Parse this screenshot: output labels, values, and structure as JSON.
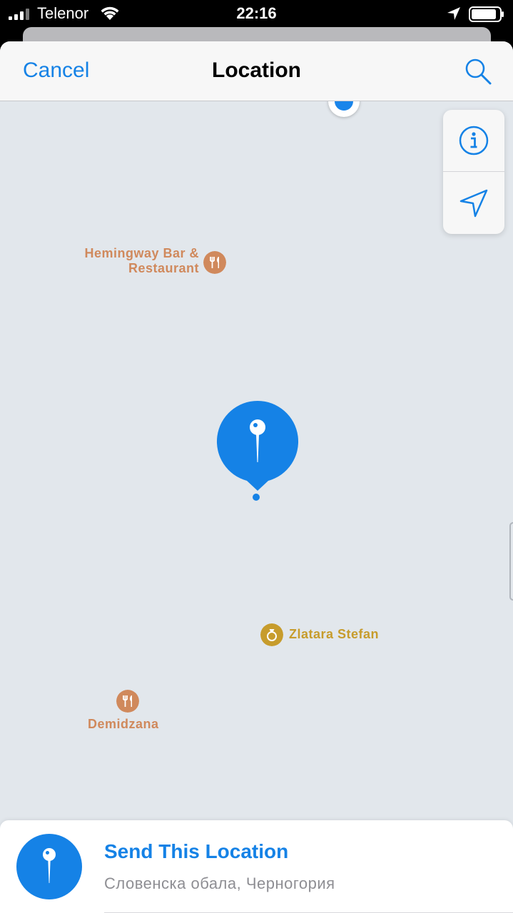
{
  "status_bar": {
    "carrier": "Telenor",
    "time": "22:16",
    "icons": [
      "signal-icon",
      "wifi-icon",
      "location-arrow-icon",
      "battery-icon"
    ]
  },
  "navbar": {
    "cancel_label": "Cancel",
    "title": "Location",
    "search_icon": "search-icon"
  },
  "map": {
    "controls": [
      "info-icon",
      "locate-arrow-icon"
    ],
    "pois": [
      {
        "line1": "Hemingway Bar &",
        "line2": "Restaurant",
        "icon": "fork-knife-icon",
        "color": "#d0895c"
      },
      {
        "line1": "Zlatara Stefan",
        "icon": "ring-icon",
        "color": "#c79c2c"
      },
      {
        "line1": "Demidzana",
        "icon": "fork-knife-icon",
        "color": "#d0895c"
      }
    ],
    "pin_icon": "map-pin-icon",
    "accent": "#1582e6"
  },
  "bottom_panel": {
    "title": "Send This Location",
    "subtitle": "Словенска обала, Черногория"
  }
}
